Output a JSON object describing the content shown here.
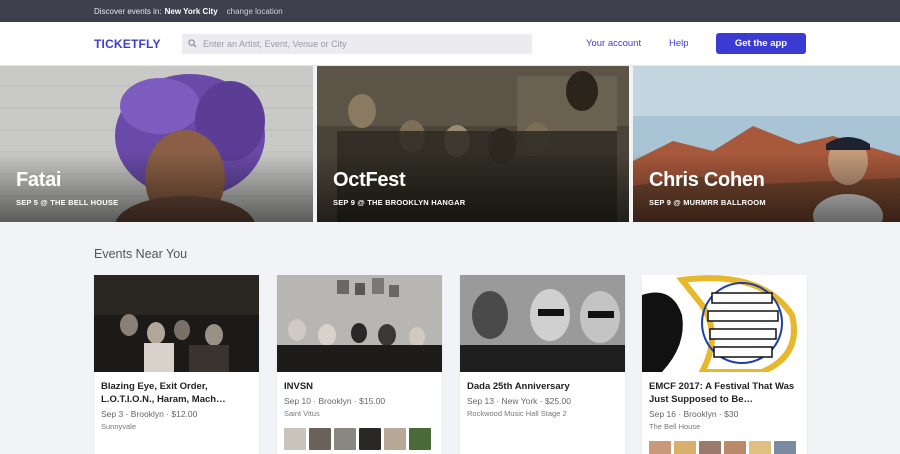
{
  "topbar": {
    "discover_label": "Discover events in:",
    "city": "New York City",
    "change_location": "change location"
  },
  "header": {
    "logo": "TICKETFLY",
    "search_placeholder": "Enter an Artist, Event, Venue or City",
    "your_account": "Your account",
    "help": "Help",
    "get_app": "Get the app"
  },
  "featured": [
    {
      "title": "Fatai",
      "subtitle": "SEP 5 @ THE BELL HOUSE"
    },
    {
      "title": "OctFest",
      "subtitle": "SEP 9 @ THE BROOKLYN HANGAR"
    },
    {
      "title": "Chris Cohen",
      "subtitle": "SEP 9 @ MURMRR BALLROOM"
    }
  ],
  "events_near_you": {
    "heading": "Events Near You",
    "cards": [
      {
        "title": "Blazing Eye, Exit Order, L.O.T.I.O.N., Haram, Mach…",
        "meta": "Sep 3 · Brooklyn · $12.00",
        "venue": "Sunnyvale"
      },
      {
        "title": "INVSN",
        "meta": "Sep 10 · Brooklyn · $15.00",
        "venue": "Saint Vitus"
      },
      {
        "title": "Dada 25th Anniversary",
        "meta": "Sep 13 · New York · $25.00",
        "venue": "Rockwood Music Hall Stage 2"
      },
      {
        "title": "EMCF 2017: A Festival That Was Just Supposed to Be…",
        "meta": "Sep 16 · Brooklyn · $30",
        "venue": "The Bell House"
      }
    ]
  },
  "colors": {
    "brand": "#3b3bd3",
    "topbar_bg": "#3d3f4c",
    "page_bg": "#f2f3f7"
  },
  "icons": {
    "search": "search-icon"
  }
}
